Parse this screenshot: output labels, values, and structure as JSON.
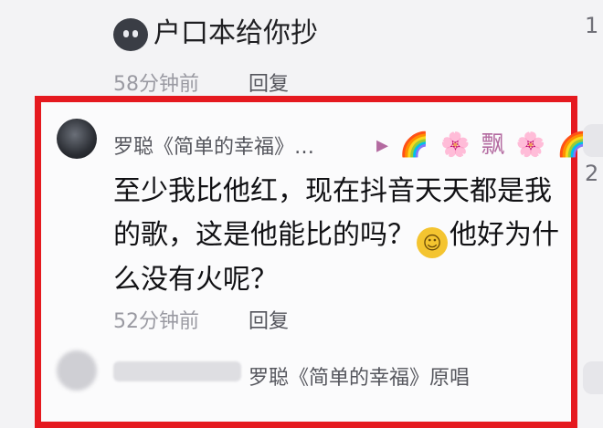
{
  "top_comment": {
    "text": "户口本给你抄",
    "time": "58分钟前",
    "reply_label": "回复"
  },
  "highlight_comment": {
    "username": "罗聪《简单的幸福》…",
    "emoji_row": "▸ 🌈 🌸 飘 🌸 🌈",
    "text_part1": "至少我比他红，现在抖音天天都是我的歌，这是他能比的吗？",
    "emoji_inline": "☺",
    "text_part2": "他好为什么没有火呢？",
    "time": "52分钟前",
    "reply_label": "回复"
  },
  "nested_reply": {
    "reply_to": "罗聪《简单的幸福》原唱"
  },
  "right_edge": {
    "count_top": "1",
    "count_mid": "2"
  },
  "colors": {
    "highlight_border": "#e5191f",
    "background": "#f3f3f5"
  }
}
